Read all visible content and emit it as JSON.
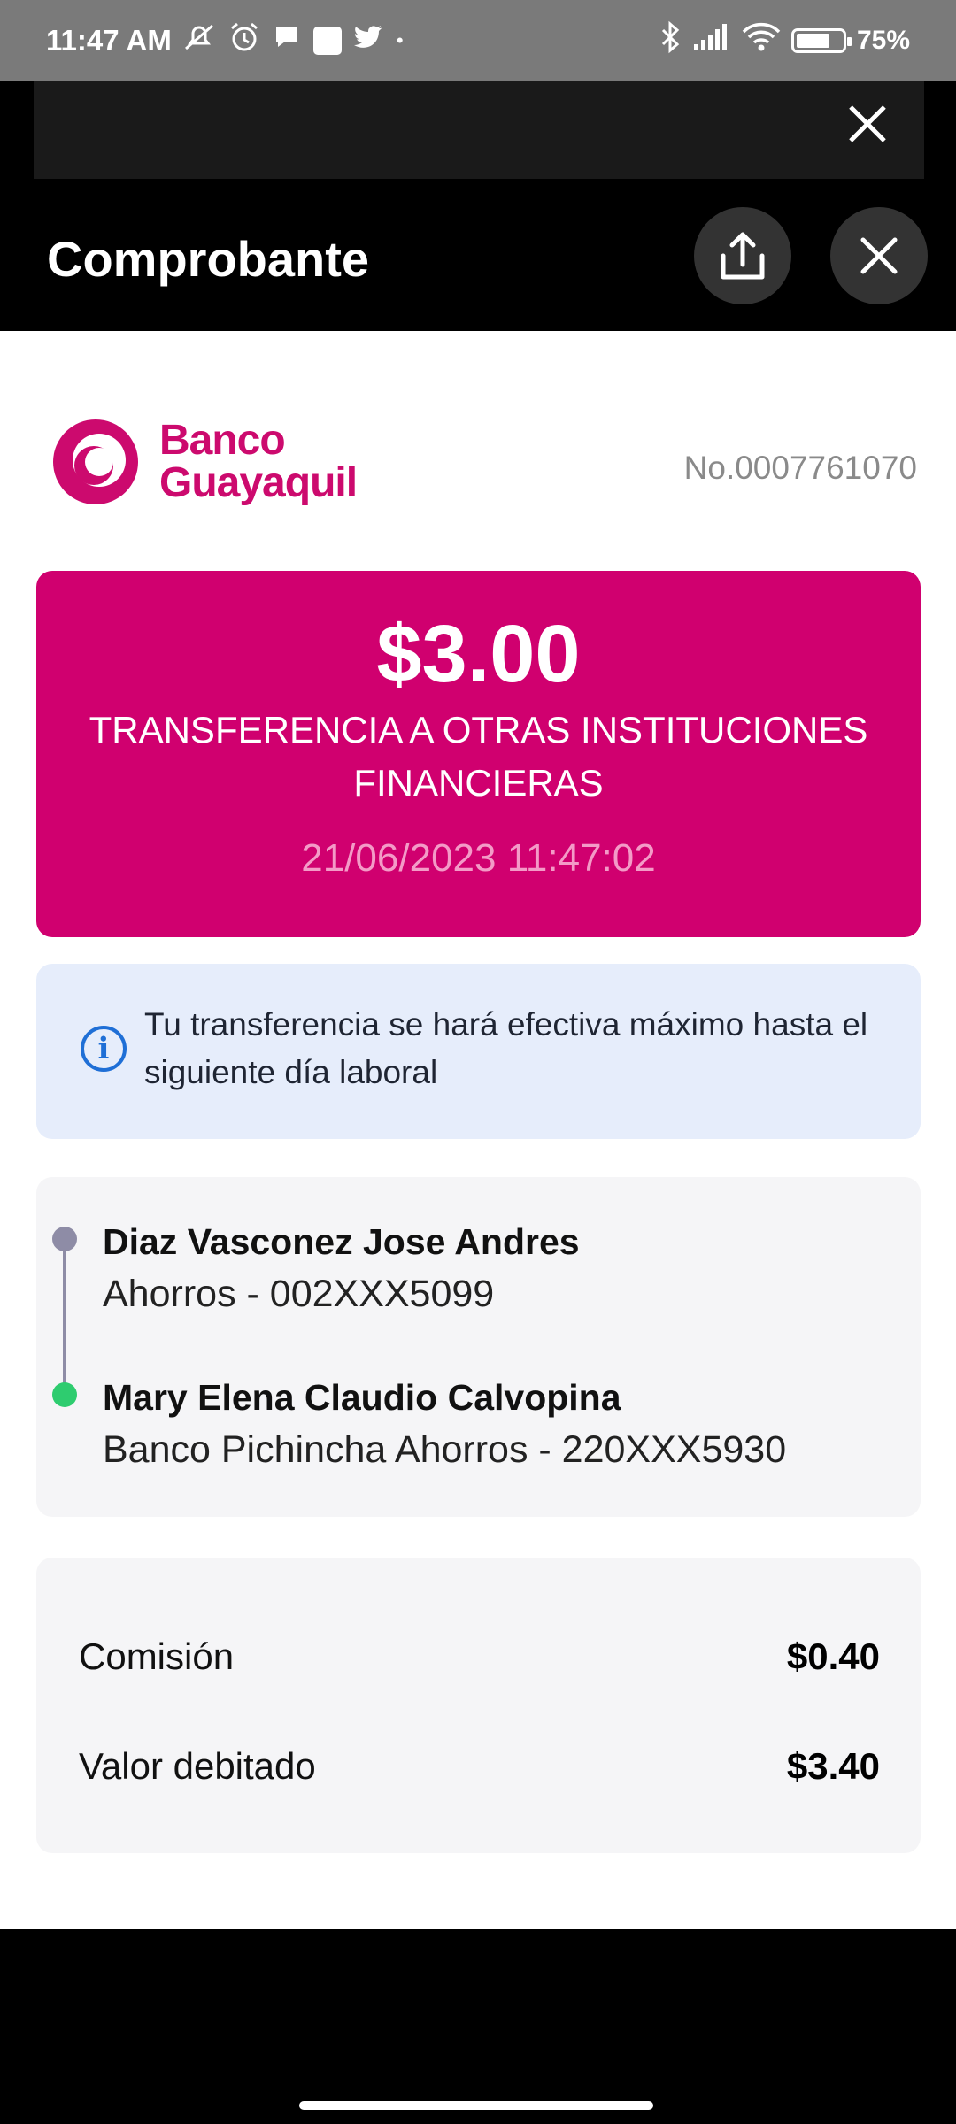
{
  "status_bar": {
    "time": "11:47 AM",
    "battery": "75%",
    "battery_level": 0.75,
    "icons": [
      "muted-bell-icon",
      "alarm-icon",
      "chat-icon",
      "square-app-icon",
      "twitter-icon",
      "dot-icon",
      "bluetooth-icon",
      "signal-icon",
      "wifi-icon",
      "battery-icon"
    ]
  },
  "header": {
    "title": "Comprobante"
  },
  "receipt": {
    "bank_name_line1": "Banco",
    "bank_name_line2": "Guayaquil",
    "number": "No.0007761070",
    "amount": "$3.00",
    "type": "TRANSFERENCIA A OTRAS INSTITUCIONES FINANCIERAS",
    "date": "21/06/2023 11:47:02",
    "brand_color": "#d0006f"
  },
  "info": {
    "message": "Tu transferencia se hará efectiva máximo hasta el siguiente día laboral"
  },
  "parties": {
    "from_name": "Diaz Vasconez Jose Andres",
    "from_account": "Ahorros - 002XXX5099",
    "to_name": "Mary Elena Claudio Calvopina",
    "to_account": "Banco Pichincha Ahorros - 220XXX5930"
  },
  "fees": [
    {
      "label": "Comisión",
      "value": "$0.40"
    },
    {
      "label": "Valor debitado",
      "value": "$3.40"
    }
  ]
}
